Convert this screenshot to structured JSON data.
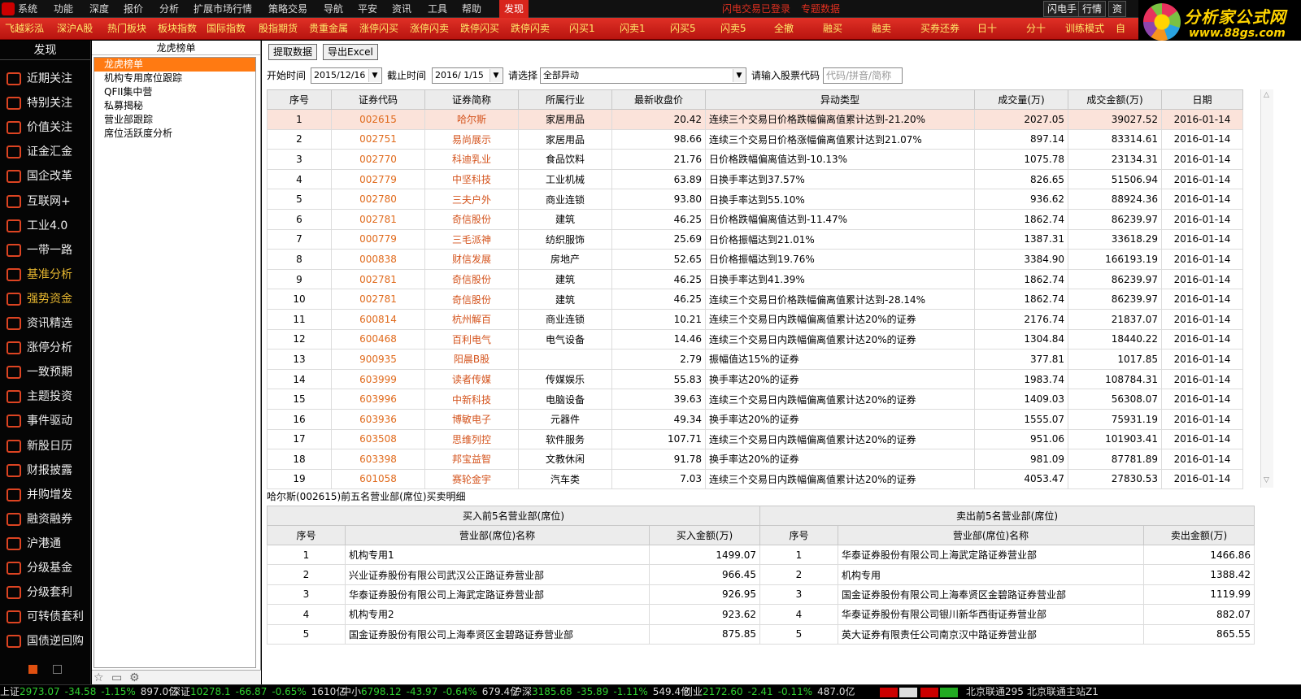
{
  "menubar": {
    "items": [
      "系统",
      "功能",
      "深度",
      "报价",
      "分析",
      "扩展市场行情",
      "策略交易",
      "导航",
      "平安",
      "资讯",
      "工具",
      "帮助",
      "发现"
    ],
    "active_index": 12,
    "notices": [
      "闪电交易已登录",
      "专题数据"
    ],
    "right_buttons": [
      "闪电手",
      "行情",
      "资"
    ]
  },
  "brand": {
    "title": "分析家公式网",
    "url": "www.88gs.com"
  },
  "funcbar": {
    "items": [
      "飞越彩泓",
      "深沪A股",
      "热门板块",
      "板块指数",
      "国际指数",
      "股指期货",
      "贵重金属",
      "涨停闪买",
      "涨停闪卖",
      "跌停闪买",
      "跌停闪卖",
      "闪买1",
      "闪卖1",
      "闪买5",
      "闪卖5",
      "全撤",
      "融买",
      "融卖",
      "买券还券",
      "日十",
      "分十",
      "训练模式",
      "自"
    ]
  },
  "leftnav": {
    "header": "发现",
    "items": [
      "近期关注",
      "特别关注",
      "价值关注",
      "证金汇金",
      "国企改革",
      "互联网+",
      "工业4.0",
      "一带一路",
      "基准分析",
      "强势资金",
      "资讯精选",
      "涨停分析",
      "一致预期",
      "主题投资",
      "事件驱动",
      "新股日历",
      "财报披露",
      "并购增发",
      "融资融券",
      "沪港通",
      "分级基金",
      "分级套利",
      "可转债套利",
      "国债逆回购"
    ],
    "highlighted": [
      8,
      9
    ]
  },
  "tree": {
    "title": "龙虎榜单",
    "items": [
      "龙虎榜单",
      "机构专用席位跟踪",
      "QFII集中营",
      "私募揭秘",
      "营业部跟踪",
      "席位活跃度分析"
    ],
    "selected_index": 0
  },
  "toolbar": {
    "fetch_label": "提取数据",
    "export_label": "导出Excel"
  },
  "filter": {
    "start_label": "开始时间",
    "start_value": "2015/12/16",
    "end_label": "截止时间",
    "end_value": "2016/ 1/15",
    "select_label": "请选择",
    "select_value": "全部异动",
    "code_label": "请输入股票代码",
    "code_placeholder": "代码/拼音/简称"
  },
  "main_table": {
    "columns": [
      "序号",
      "证券代码",
      "证券简称",
      "所属行业",
      "最新收盘价",
      "异动类型",
      "成交量(万)",
      "成交金额(万)",
      "日期"
    ],
    "selected_row": 0,
    "rows": [
      [
        "1",
        "002615",
        "哈尔斯",
        "家居用品",
        "20.42",
        "连续三个交易日价格跌幅偏离值累计达到-21.20%",
        "2027.05",
        "39027.52",
        "2016-01-14"
      ],
      [
        "2",
        "002751",
        "易尚展示",
        "家居用品",
        "98.66",
        "连续三个交易日价格涨幅偏离值累计达到21.07%",
        "897.14",
        "83314.61",
        "2016-01-14"
      ],
      [
        "3",
        "002770",
        "科迪乳业",
        "食品饮料",
        "21.76",
        "日价格跌幅偏离值达到-10.13%",
        "1075.78",
        "23134.31",
        "2016-01-14"
      ],
      [
        "4",
        "002779",
        "中坚科技",
        "工业机械",
        "63.89",
        "日换手率达到37.57%",
        "826.65",
        "51506.94",
        "2016-01-14"
      ],
      [
        "5",
        "002780",
        "三夫户外",
        "商业连锁",
        "93.80",
        "日换手率达到55.10%",
        "936.62",
        "88924.36",
        "2016-01-14"
      ],
      [
        "6",
        "002781",
        "奇信股份",
        "建筑",
        "46.25",
        "日价格跌幅偏离值达到-11.47%",
        "1862.74",
        "86239.97",
        "2016-01-14"
      ],
      [
        "7",
        "000779",
        "三毛派神",
        "纺织服饰",
        "25.69",
        "日价格振幅达到21.01%",
        "1387.31",
        "33618.29",
        "2016-01-14"
      ],
      [
        "8",
        "000838",
        "财信发展",
        "房地产",
        "52.65",
        "日价格振幅达到19.76%",
        "3384.90",
        "166193.19",
        "2016-01-14"
      ],
      [
        "9",
        "002781",
        "奇信股份",
        "建筑",
        "46.25",
        "日换手率达到41.39%",
        "1862.74",
        "86239.97",
        "2016-01-14"
      ],
      [
        "10",
        "002781",
        "奇信股份",
        "建筑",
        "46.25",
        "连续三个交易日价格跌幅偏离值累计达到-28.14%",
        "1862.74",
        "86239.97",
        "2016-01-14"
      ],
      [
        "11",
        "600814",
        "杭州解百",
        "商业连锁",
        "10.21",
        "连续三个交易日内跌幅偏离值累计达20%的证券",
        "2176.74",
        "21837.07",
        "2016-01-14"
      ],
      [
        "12",
        "600468",
        "百利电气",
        "电气设备",
        "14.46",
        "连续三个交易日内跌幅偏离值累计达20%的证券",
        "1304.84",
        "18440.22",
        "2016-01-14"
      ],
      [
        "13",
        "900935",
        "阳晨B股",
        "",
        "2.79",
        "振幅值达15%的证券",
        "377.81",
        "1017.85",
        "2016-01-14"
      ],
      [
        "14",
        "603999",
        "读者传媒",
        "传媒娱乐",
        "55.83",
        "换手率达20%的证券",
        "1983.74",
        "108784.31",
        "2016-01-14"
      ],
      [
        "15",
        "603996",
        "中新科技",
        "电脑设备",
        "39.63",
        "连续三个交易日内跌幅偏离值累计达20%的证券",
        "1409.03",
        "56308.07",
        "2016-01-14"
      ],
      [
        "16",
        "603936",
        "博敏电子",
        "元器件",
        "49.34",
        "换手率达20%的证券",
        "1555.07",
        "75931.19",
        "2016-01-14"
      ],
      [
        "17",
        "603508",
        "思维列控",
        "软件服务",
        "107.71",
        "连续三个交易日内跌幅偏离值累计达20%的证券",
        "951.06",
        "101903.41",
        "2016-01-14"
      ],
      [
        "18",
        "603398",
        "邦宝益智",
        "文教休闲",
        "91.78",
        "换手率达20%的证券",
        "981.09",
        "87781.89",
        "2016-01-14"
      ],
      [
        "19",
        "601058",
        "赛轮金宇",
        "汽车类",
        "7.03",
        "连续三个交易日内跌幅偏离值累计达20%的证券",
        "4053.47",
        "27830.53",
        "2016-01-14"
      ]
    ]
  },
  "detail": {
    "title": "哈尔斯(002615)前五名营业部(席位)买卖明细",
    "buy": {
      "header": "买入前5名营业部(席位)",
      "columns": [
        "序号",
        "营业部(席位)名称",
        "买入金额(万)"
      ],
      "rows": [
        [
          "1",
          "机构专用1",
          "1499.07"
        ],
        [
          "2",
          "兴业证券股份有限公司武汉公正路证券营业部",
          "966.45"
        ],
        [
          "3",
          "华泰证券股份有限公司上海武定路证券营业部",
          "926.95"
        ],
        [
          "4",
          "机构专用2",
          "923.62"
        ],
        [
          "5",
          "国金证券股份有限公司上海奉贤区金碧路证券营业部",
          "875.85"
        ]
      ]
    },
    "sell": {
      "header": "卖出前5名营业部(席位)",
      "columns": [
        "序号",
        "营业部(席位)名称",
        "卖出金额(万)"
      ],
      "rows": [
        [
          "1",
          "华泰证券股份有限公司上海武定路证券营业部",
          "1466.86"
        ],
        [
          "2",
          "机构专用",
          "1388.42"
        ],
        [
          "3",
          "国金证券股份有限公司上海奉贤区金碧路证券营业部",
          "1119.99"
        ],
        [
          "4",
          "华泰证券股份有限公司银川新华西街证券营业部",
          "882.07"
        ],
        [
          "5",
          "英大证券有限责任公司南京汉中路证券营业部",
          "865.55"
        ]
      ]
    }
  },
  "statusbar": {
    "segments": [
      {
        "label": "上证",
        "value": "2973.07",
        "change": "-34.58",
        "pct": "-1.15%",
        "amount": "897.0亿"
      },
      {
        "label": "深证",
        "value": "10278.1",
        "change": "-66.87",
        "pct": "-0.65%",
        "amount": "1610亿"
      },
      {
        "label": "中小",
        "value": "6798.12",
        "change": "-43.97",
        "pct": "-0.64%",
        "amount": "679.4亿"
      },
      {
        "label": "沪深",
        "value": "3185.68",
        "change": "-35.89",
        "pct": "-1.11%",
        "amount": "549.4亿"
      },
      {
        "label": "创业",
        "value": "2172.60",
        "change": "-2.41",
        "pct": "-0.11%",
        "amount": "487.0亿"
      }
    ],
    "servers": [
      "北京联通295",
      "北京联通主站Z1"
    ]
  },
  "colors": {
    "accent_red": "#d8251c",
    "code_orange": "#e06a1c",
    "selected_row": "#fbe3da",
    "tree_selected": "#ff7a12",
    "ticker_green": "#30d030"
  }
}
